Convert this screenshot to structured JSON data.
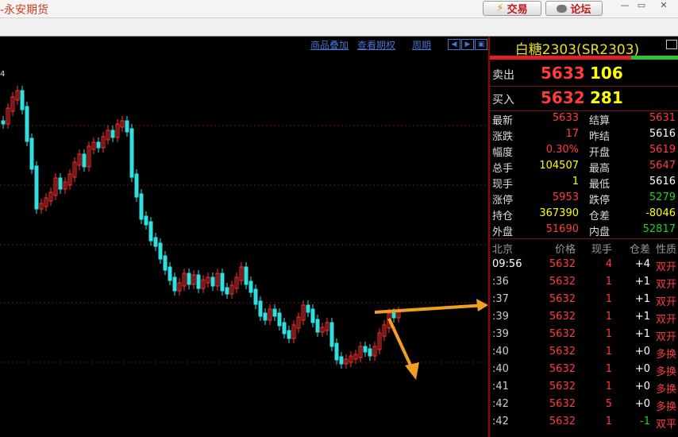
{
  "app": {
    "title": "-永安期货",
    "trade_label": "交易",
    "forum_label": "论坛"
  },
  "chart_menu": {
    "overlay": "商品叠加",
    "options": "查看期权",
    "period": "周期"
  },
  "chart": {
    "top_label": "4"
  },
  "contract": {
    "title": "白糖2303(SR2303)"
  },
  "quotes": {
    "sell": {
      "label": "卖出",
      "price": "5633",
      "volume": "106"
    },
    "buy": {
      "label": "买入",
      "price": "5632",
      "volume": "281"
    }
  },
  "stats": [
    {
      "l1": "最新",
      "v1": "5633",
      "c1": "red",
      "l2": "结算",
      "v2": "5631",
      "c2": "red"
    },
    {
      "l1": "涨跌",
      "v1": "17",
      "c1": "red",
      "l2": "昨结",
      "v2": "5616",
      "c2": "white"
    },
    {
      "l1": "幅度",
      "v1": "0.30%",
      "c1": "red",
      "l2": "开盘",
      "v2": "5619",
      "c2": "red"
    },
    {
      "l1": "总手",
      "v1": "104507",
      "c1": "yellow",
      "l2": "最高",
      "v2": "5647",
      "c2": "red"
    },
    {
      "l1": "现手",
      "v1": "1",
      "c1": "yellow",
      "l2": "最低",
      "v2": "5616",
      "c2": "white"
    },
    {
      "l1": "涨停",
      "v1": "5953",
      "c1": "red",
      "l2": "跌停",
      "v2": "5279",
      "c2": "green"
    },
    {
      "l1": "持仓",
      "v1": "367390",
      "c1": "yellow",
      "l2": "仓差",
      "v2": "-8046",
      "c2": "yellow"
    },
    {
      "l1": "外盘",
      "v1": "51690",
      "c1": "red",
      "l2": "内盘",
      "v2": "52817",
      "c2": "green"
    }
  ],
  "ticks_header": {
    "time": "北京",
    "price": "价格",
    "vol": "现手",
    "diff": "仓差",
    "type": "性质"
  },
  "ticks": [
    {
      "time": "09:56",
      "price": "5632",
      "vol": "4",
      "diff": "+4",
      "type": "双开"
    },
    {
      "time": ":36",
      "price": "5632",
      "vol": "1",
      "diff": "+1",
      "type": "双开"
    },
    {
      "time": ":37",
      "price": "5632",
      "vol": "1",
      "diff": "+1",
      "type": "双开"
    },
    {
      "time": ":39",
      "price": "5632",
      "vol": "1",
      "diff": "+1",
      "type": "双开"
    },
    {
      "time": ":39",
      "price": "5632",
      "vol": "1",
      "diff": "+1",
      "type": "双开"
    },
    {
      "time": ":40",
      "price": "5632",
      "vol": "1",
      "diff": "+0",
      "type": "多换"
    },
    {
      "time": ":40",
      "price": "5632",
      "vol": "1",
      "diff": "+0",
      "type": "多换"
    },
    {
      "time": ":41",
      "price": "5632",
      "vol": "1",
      "diff": "+0",
      "type": "多换"
    },
    {
      "time": ":42",
      "price": "5632",
      "vol": "5",
      "diff": "+0",
      "type": "多换"
    },
    {
      "time": ":42",
      "price": "5632",
      "vol": "1",
      "diff": "-1",
      "type": "双平"
    }
  ]
}
